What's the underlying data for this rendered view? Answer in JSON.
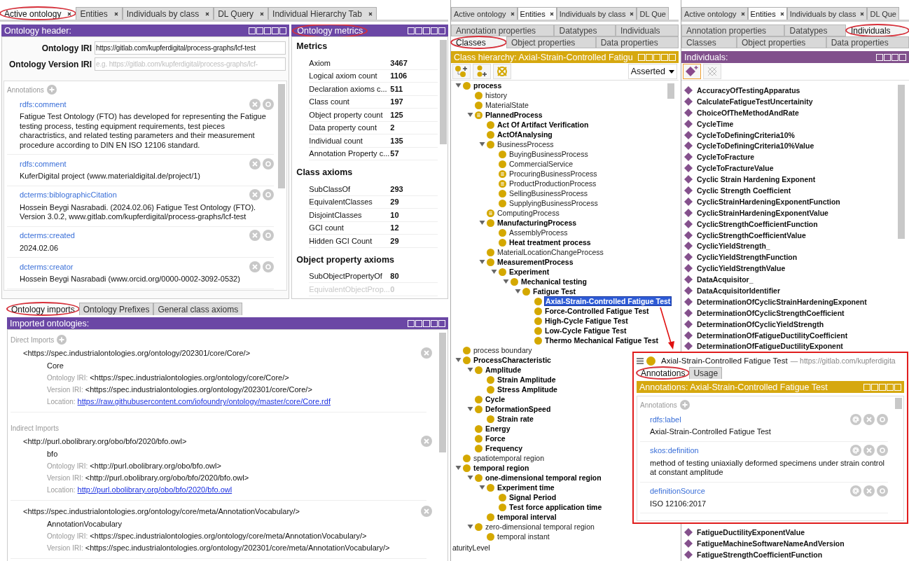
{
  "left": {
    "tabs": [
      {
        "label": "Active ontology",
        "selected": true,
        "circled": true,
        "closable": true
      },
      {
        "label": "Entities",
        "selected": false,
        "circled": false,
        "closable": true
      },
      {
        "label": "Individuals by class",
        "selected": false,
        "circled": false,
        "closable": true
      },
      {
        "label": "DL Query",
        "selected": false,
        "circled": false,
        "closable": true
      },
      {
        "label": "Individual Hierarchy Tab",
        "selected": false,
        "circled": false,
        "closable": true
      }
    ],
    "ontology_header": {
      "title": "Ontology header:",
      "circled": false,
      "fields": [
        {
          "label": "Ontology IRI",
          "value": "https://gitlab.com/kupferdigital/process-graphs/lcf-test"
        },
        {
          "label": "Ontology Version IRI",
          "placeholder": "e.g. https://gitlab.com/kupferdigital/process-graphs/lcf-"
        }
      ],
      "annotations_label": "Annotations",
      "annotations": [
        {
          "property": "rdfs:comment",
          "value": "Fatigue Test Ontology (FTO) has developed for representing the Fatigue testing process, testing equipment requirements, test pieces charactristics, and related testing parameters and their measurement procedure according to DIN EN ISO 12106 standard."
        },
        {
          "property": "rdfs:comment",
          "value": "KuferDigital project (www.materialdigital.de/project/1)"
        },
        {
          "property": "dcterms:biblographicCitation",
          "value": "Hossein Beygi Nasrabadi. (2024.02.06) Fatigue Test Ontology (FTO). Version 3.0.2, www.gitlab.com/kupferdigital/process-graphs/lcf-test"
        },
        {
          "property": "dcterms:created",
          "value": "2024.02.06"
        },
        {
          "property": "dcterms:creator",
          "value": "Hossein Beygi Nasrabadi (www.orcid.org/0000-0002-3092-0532)"
        }
      ]
    },
    "ontology_metrics": {
      "title": "Ontology metrics",
      "circled": true,
      "sections": [
        {
          "heading": "Metrics",
          "rows": [
            {
              "name": "Axiom",
              "value": "3467",
              "dimmed": false
            },
            {
              "name": "Logical axiom count",
              "value": "1106",
              "dimmed": false
            },
            {
              "name": "Declaration axioms c...",
              "value": "511",
              "dimmed": false
            },
            {
              "name": "Class count",
              "value": "197",
              "dimmed": false
            },
            {
              "name": "Object property count",
              "value": "125",
              "dimmed": false
            },
            {
              "name": "Data property count",
              "value": "2",
              "dimmed": false
            },
            {
              "name": "Individual count",
              "value": "135",
              "dimmed": false
            },
            {
              "name": "Annotation Property c...",
              "value": "57",
              "dimmed": false
            }
          ]
        },
        {
          "heading": "Class axioms",
          "rows": [
            {
              "name": "SubClassOf",
              "value": "293",
              "dimmed": false
            },
            {
              "name": "EquivalentClasses",
              "value": "29",
              "dimmed": false
            },
            {
              "name": "DisjointClasses",
              "value": "10",
              "dimmed": false
            },
            {
              "name": "GCI count",
              "value": "12",
              "dimmed": false
            },
            {
              "name": "Hidden GCI Count",
              "value": "29",
              "dimmed": false
            }
          ]
        },
        {
          "heading": "Object property axioms",
          "rows": [
            {
              "name": "SubObjectPropertyOf",
              "value": "80",
              "dimmed": false
            },
            {
              "name": "EquivalentObjectProp...",
              "value": "0",
              "dimmed": true
            }
          ]
        }
      ]
    },
    "bottom_tabs": [
      {
        "label": "Ontology imports",
        "selected": true,
        "circled": true
      },
      {
        "label": "Ontology Prefixes",
        "selected": false,
        "circled": false
      },
      {
        "label": "General class axioms",
        "selected": false,
        "circled": false
      }
    ],
    "imports_panel": {
      "title": "Imported ontologies:",
      "sections": [
        {
          "heading": "Direct Imports",
          "can_add": true,
          "imports": [
            {
              "iri": "<https://spec.industrialontologies.org/ontology/202301/core/Core/>",
              "name": "Core",
              "details": [
                {
                  "label": "Ontology IRI:",
                  "value": "<https://spec.industrialontologies.org/ontology/core/Core/>",
                  "kind": "text"
                },
                {
                  "label": "Version IRI:",
                  "value": "<https://spec.industrialontologies.org/ontology/202301/core/Core/>",
                  "kind": "text"
                },
                {
                  "label": "Location:",
                  "value": "https://raw.githubusercontent.com/iofoundry/ontology/master/core/Core.rdf",
                  "kind": "link"
                }
              ]
            }
          ]
        },
        {
          "heading": "Indirect Imports",
          "can_add": false,
          "imports": [
            {
              "iri": "<http://purl.obolibrary.org/obo/bfo/2020/bfo.owl>",
              "name": "bfo",
              "details": [
                {
                  "label": "Ontology IRI:",
                  "value": "<http://purl.obolibrary.org/obo/bfo.owl>",
                  "kind": "text"
                },
                {
                  "label": "Version IRI:",
                  "value": "<http://purl.obolibrary.org/obo/bfo/2020/bfo.owl>",
                  "kind": "text"
                },
                {
                  "label": "Location:",
                  "value": "http://purl.obolibrary.org/obo/bfo/2020/bfo.owl",
                  "kind": "link"
                }
              ]
            },
            {
              "iri": "<https://spec.industrialontologies.org/ontology/core/meta/AnnotationVocabulary/>",
              "name": "AnnotationVocabulary",
              "details": [
                {
                  "label": "Ontology IRI:",
                  "value": "<https://spec.industrialontologies.org/ontology/core/meta/AnnotationVocabulary/>",
                  "kind": "text"
                },
                {
                  "label": "Version IRI:",
                  "value": "<https://spec.industrialontologies.org/ontology/202301/core/meta/AnnotationVocabulary/>",
                  "kind": "text"
                }
              ]
            }
          ]
        }
      ]
    }
  },
  "middle": {
    "tabs": [
      {
        "label": "Active ontology",
        "selected": false,
        "circled": false,
        "closable": true
      },
      {
        "label": "Entities",
        "selected": true,
        "circled": false,
        "closable": true
      },
      {
        "label": "Individuals by class",
        "selected": false,
        "circled": false,
        "closable": true
      },
      {
        "label": "DL Que",
        "selected": false,
        "circled": false,
        "closable": false
      }
    ],
    "entity_tabs": [
      [
        {
          "label": "Annotation properties",
          "selected": false,
          "circled": false
        },
        {
          "label": "Datatypes",
          "selected": false,
          "circled": false
        },
        {
          "label": "Individuals",
          "selected": false,
          "circled": false
        }
      ],
      [
        {
          "label": "Classes",
          "selected": true,
          "circled": true
        },
        {
          "label": "Object properties",
          "selected": false,
          "circled": false
        },
        {
          "label": "Data properties",
          "selected": false,
          "circled": false
        }
      ]
    ],
    "class_hierarchy": {
      "title": "Class hierarchy: Axial-Strain-Controlled Fatigu",
      "mode": "Asserted",
      "tree": [
        {
          "label": "process",
          "bold": true,
          "kind": "primitive",
          "selected": false,
          "expanded": true,
          "children": [
            {
              "label": "history",
              "bold": false,
              "kind": "primitive",
              "selected": false
            },
            {
              "label": "MaterialState",
              "bold": false,
              "kind": "primitive",
              "selected": false
            },
            {
              "label": "PlannedProcess",
              "bold": true,
              "kind": "defined",
              "selected": false,
              "expanded": true,
              "children": [
                {
                  "label": "Act Of Artifact Verification",
                  "bold": true,
                  "kind": "primitive",
                  "selected": false
                },
                {
                  "label": "ActOfAnalysing",
                  "bold": true,
                  "kind": "primitive",
                  "selected": false
                },
                {
                  "label": "BusinessProcess",
                  "bold": false,
                  "kind": "primitive",
                  "selected": false,
                  "expanded": true,
                  "children": [
                    {
                      "label": "BuyingBusinessProcess",
                      "bold": false,
                      "kind": "primitive",
                      "selected": false
                    },
                    {
                      "label": "CommercialService",
                      "bold": false,
                      "kind": "primitive",
                      "selected": false
                    },
                    {
                      "label": "ProcuringBusinessProcess",
                      "bold": false,
                      "kind": "defined",
                      "selected": false
                    },
                    {
                      "label": "ProductProductionProcess",
                      "bold": false,
                      "kind": "defined",
                      "selected": false
                    },
                    {
                      "label": "SellingBusinessProcess",
                      "bold": false,
                      "kind": "primitive",
                      "selected": false
                    },
                    {
                      "label": "SupplyingBusinessProcess",
                      "bold": false,
                      "kind": "primitive",
                      "selected": false
                    }
                  ]
                },
                {
                  "label": "ComputingProcess",
                  "bold": false,
                  "kind": "defined",
                  "selected": false
                },
                {
                  "label": "ManufacturingProcess",
                  "bold": true,
                  "kind": "primitive",
                  "selected": false,
                  "expanded": true,
                  "children": [
                    {
                      "label": "AssemblyProcess",
                      "bold": false,
                      "kind": "primitive",
                      "selected": false
                    },
                    {
                      "label": "Heat treatment process",
                      "bold": true,
                      "kind": "primitive",
                      "selected": false
                    }
                  ]
                },
                {
                  "label": "MaterialLocationChangeProcess",
                  "bold": false,
                  "kind": "primitive",
                  "selected": false
                },
                {
                  "label": "MeasurementProcess",
                  "bold": true,
                  "kind": "primitive",
                  "selected": false,
                  "expanded": true,
                  "children": [
                    {
                      "label": "Experiment",
                      "bold": true,
                      "kind": "primitive",
                      "selected": false,
                      "expanded": true,
                      "children": [
                        {
                          "label": "Mechanical testing",
                          "bold": true,
                          "kind": "primitive",
                          "selected": false,
                          "expanded": true,
                          "children": [
                            {
                              "label": "Fatigue Test",
                              "bold": true,
                              "kind": "primitive",
                              "selected": false,
                              "expanded": true,
                              "children": [
                                {
                                  "label": "Axial-Strain-Controlled Fatigue Test",
                                  "bold": true,
                                  "kind": "primitive",
                                  "selected": true
                                },
                                {
                                  "label": "Force-Controlled Fatigue Test",
                                  "bold": true,
                                  "kind": "primitive",
                                  "selected": false
                                },
                                {
                                  "label": "High-Cycle Fatigue Test",
                                  "bold": true,
                                  "kind": "primitive",
                                  "selected": false
                                },
                                {
                                  "label": "Low-Cycle Fatigue Test",
                                  "bold": true,
                                  "kind": "primitive",
                                  "selected": false
                                },
                                {
                                  "label": "Thermo Mechanical Fatigue Test",
                                  "bold": true,
                                  "kind": "primitive",
                                  "selected": false
                                }
                              ]
                            }
                          ]
                        }
                      ]
                    }
                  ]
                }
              ]
            }
          ]
        },
        {
          "label": "process boundary",
          "bold": false,
          "kind": "primitive",
          "selected": false
        },
        {
          "label": "ProcessCharacteristic",
          "bold": true,
          "kind": "primitive",
          "selected": false,
          "expanded": true,
          "children": [
            {
              "label": "Amplitude",
              "bold": true,
              "kind": "primitive",
              "selected": false,
              "expanded": true,
              "children": [
                {
                  "label": "Strain Amplitude",
                  "bold": true,
                  "kind": "primitive",
                  "selected": false
                },
                {
                  "label": "Stress Amplitude",
                  "bold": true,
                  "kind": "primitive",
                  "selected": false
                }
              ]
            },
            {
              "label": "Cycle",
              "bold": true,
              "kind": "primitive",
              "selected": false
            },
            {
              "label": "DeformationSpeed",
              "bold": true,
              "kind": "primitive",
              "selected": false,
              "expanded": true,
              "children": [
                {
                  "label": "Strain rate",
                  "bold": true,
                  "kind": "primitive",
                  "selected": false
                }
              ]
            },
            {
              "label": "Energy",
              "bold": true,
              "kind": "primitive",
              "selected": false
            },
            {
              "label": "Force",
              "bold": true,
              "kind": "primitive",
              "selected": false
            },
            {
              "label": "Frequency",
              "bold": true,
              "kind": "primitive",
              "selected": false
            }
          ]
        },
        {
          "label": "spatiotemporal region",
          "bold": false,
          "kind": "primitive",
          "selected": false
        },
        {
          "label": "temporal region",
          "bold": true,
          "kind": "primitive",
          "selected": false,
          "expanded": true,
          "children": [
            {
              "label": "one-dimensional temporal region",
              "bold": true,
              "kind": "primitive",
              "selected": false,
              "expanded": true,
              "children": [
                {
                  "label": "Experiment time",
                  "bold": true,
                  "kind": "primitive",
                  "selected": false,
                  "expanded": true,
                  "children": [
                    {
                      "label": "Signal Period",
                      "bold": true,
                      "kind": "primitive",
                      "selected": false
                    },
                    {
                      "label": "Test force application time",
                      "bold": true,
                      "kind": "primitive",
                      "selected": false
                    }
                  ]
                },
                {
                  "label": "temporal interval",
                  "bold": true,
                  "kind": "primitive",
                  "selected": false
                }
              ]
            },
            {
              "label": "zero-dimensional temporal region",
              "bold": false,
              "kind": "primitive",
              "selected": false,
              "expanded": true,
              "children": [
                {
                  "label": "temporal instant",
                  "bold": false,
                  "kind": "primitive",
                  "selected": false
                }
              ]
            }
          ]
        }
      ],
      "cut_row": "aturityLevel"
    }
  },
  "right": {
    "tabs": [
      {
        "label": "Active ontology",
        "selected": false,
        "circled": false,
        "closable": true
      },
      {
        "label": "Entities",
        "selected": true,
        "circled": false,
        "closable": true
      },
      {
        "label": "Individuals by class",
        "selected": false,
        "circled": false,
        "closable": true
      },
      {
        "label": "DL Que",
        "selected": false,
        "circled": false,
        "closable": false
      }
    ],
    "entity_tabs": [
      [
        {
          "label": "Annotation properties",
          "selected": false,
          "circled": false
        },
        {
          "label": "Datatypes",
          "selected": false,
          "circled": false
        },
        {
          "label": "Individuals",
          "selected": true,
          "circled": true
        }
      ],
      [
        {
          "label": "Classes",
          "selected": false,
          "circled": false
        },
        {
          "label": "Object properties",
          "selected": false,
          "circled": false
        },
        {
          "label": "Data properties",
          "selected": false,
          "circled": false
        }
      ]
    ],
    "individuals": {
      "title": "Individuals:",
      "items_above": [
        "AccuracyOfTestingApparatus",
        "CalculateFatigueTestUncertainity",
        "ChoiceOfTheMethodAndRate",
        "CycleTime",
        "CycleToDefiningCriteria10%",
        "CycleToDefiningCriteria10%Value",
        "CycleToFracture",
        "CycleToFractureValue",
        "Cyclic Strain Hardening Exponent",
        "Cyclic Strength Coefficient",
        "CyclicStrainHardeningExponentFunction",
        "CyclicStrainHardeningExponentValue",
        "CyclicStrengthCoefficientFunction",
        "CyclicStrengthCoefficientValue",
        "CyclicYieldStrength_",
        "CyclicYieldStrengthFunction",
        "CyclicYieldStrengthValue",
        "DataAcquisitor_",
        "DataAcquisitorIdentifier",
        "DeterminationOfCyclicStrainHardeningExponent",
        "DeterminationOfCyclicStrengthCoefficient",
        "DeterminationOfCyclicYieldStrength",
        "DeterminationOfFatigueDuctilityCoefficient",
        "DeterminationOfFatigueDuctilityExponent"
      ],
      "items_below": [
        "FatigueDuctilityExponentValue",
        "FatigueMachineSoftwareNameAndVersion",
        "FatigueStrengthCoefficientFunction"
      ]
    }
  },
  "popup": {
    "entity": "Axial-Strain-Controlled Fatigue Test",
    "iri": "— https://gitlab.com/kupferdigita",
    "tabs": [
      {
        "label": "Annotations",
        "selected": true,
        "circled": true
      },
      {
        "label": "Usage",
        "selected": false,
        "circled": false
      }
    ],
    "title": "Annotations: Axial-Strain-Controlled Fatigue Test",
    "annotations_label": "Annotations",
    "annotations": [
      {
        "property": "rdfs:label",
        "value": "Axial-Strain-Controlled Fatigue Test"
      },
      {
        "property": "skos:definition",
        "value": "method of testing uniaxially deformed specimens under strain control at constant amplitude"
      },
      {
        "property": "definitionSource",
        "value": "ISO 12106:2017"
      }
    ]
  }
}
